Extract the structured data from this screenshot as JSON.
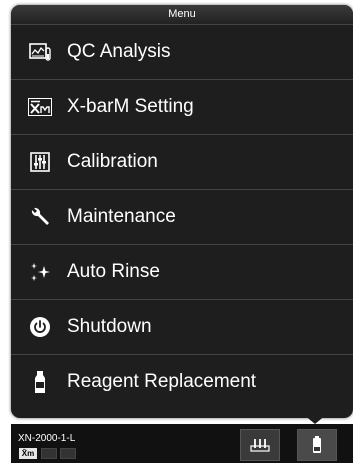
{
  "menu": {
    "title": "Menu",
    "items": [
      {
        "label": "QC Analysis",
        "icon": "qc-analysis-icon"
      },
      {
        "label": "X-barM Setting",
        "icon": "xbarm-icon"
      },
      {
        "label": "Calibration",
        "icon": "calibration-icon"
      },
      {
        "label": "Maintenance",
        "icon": "wrench-icon"
      },
      {
        "label": "Auto Rinse",
        "icon": "sparkle-icon"
      },
      {
        "label": "Shutdown",
        "icon": "power-icon"
      },
      {
        "label": "Reagent Replacement",
        "icon": "reagent-bottle-icon"
      }
    ]
  },
  "status_bar": {
    "device_name": "XN-2000-1-L",
    "xm_badge": "X̄m"
  },
  "colors": {
    "panel_bg": "#1e1e1e",
    "text": "#ffffff",
    "separator": "#444444"
  }
}
